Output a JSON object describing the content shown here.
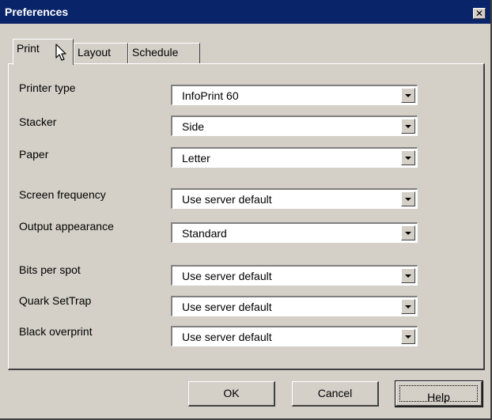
{
  "window": {
    "title": "Preferences",
    "close_glyph": "✕"
  },
  "tabs": [
    {
      "label": "Print",
      "active": true
    },
    {
      "label": "Layout",
      "active": false
    },
    {
      "label": "Schedule",
      "active": false
    }
  ],
  "fields": [
    {
      "label": "Printer type",
      "value": "InfoPrint 60"
    },
    {
      "label": "Stacker",
      "value": "Side"
    },
    {
      "label": "Paper",
      "value": "Letter"
    },
    {
      "label": "Screen frequency",
      "value": "Use server default"
    },
    {
      "label": "Output appearance",
      "value": "Standard"
    },
    {
      "label": "Bits per spot",
      "value": "Use server default"
    },
    {
      "label": "Quark SetTrap",
      "value": "Use server default"
    },
    {
      "label": "Black overprint",
      "value": "Use server default"
    }
  ],
  "buttons": {
    "ok": "OK",
    "cancel": "Cancel",
    "help": "Help"
  },
  "colors": {
    "titlebar": "#0a246a",
    "face": "#d4d0c8"
  },
  "icons": {
    "cursor": "mouse-pointer-icon",
    "dropdown": "chevron-down-icon"
  }
}
